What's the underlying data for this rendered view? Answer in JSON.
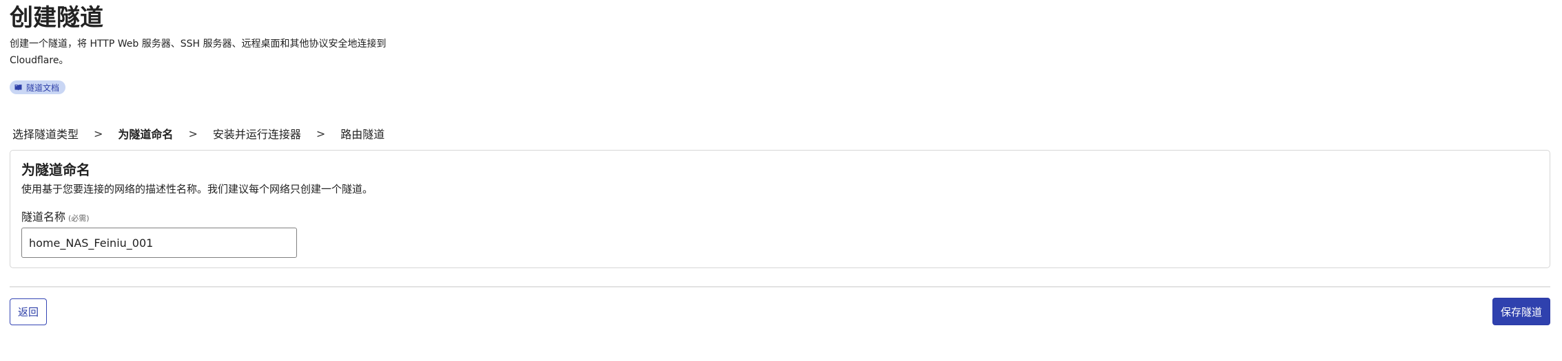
{
  "header": {
    "title": "创建隧道",
    "description": "创建一个隧道，将 HTTP Web 服务器、SSH 服务器、远程桌面和其他协议安全地连接到 Cloudflare。",
    "doc_link_label": "隧道文档",
    "doc_link_icon": "book-icon"
  },
  "steps": [
    {
      "label": "选择隧道类型",
      "active": false
    },
    {
      "label": "为隧道命名",
      "active": true
    },
    {
      "label": "安装并运行连接器",
      "active": false
    },
    {
      "label": "路由隧道",
      "active": false
    }
  ],
  "step_separator": ">",
  "card": {
    "title": "为隧道命名",
    "subtitle": "使用基于您要连接的网络的描述性名称。我们建议每个网络只创建一个隧道。",
    "field_label": "隧道名称",
    "field_required": "(必需)",
    "field_value": "home_NAS_Feiniu_001"
  },
  "footer": {
    "back_label": "返回",
    "save_label": "保存隧道"
  },
  "colors": {
    "accent": "#2f41ae",
    "badge_bg": "#c9d6f4"
  }
}
